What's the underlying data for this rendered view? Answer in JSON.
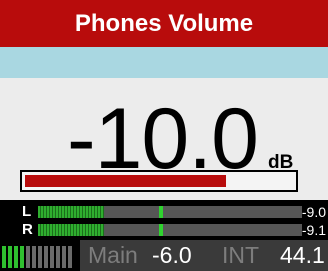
{
  "title": "Phones Volume",
  "volume": {
    "value": "-10.0",
    "unit": "dB",
    "level_fraction": 0.75
  },
  "meters": {
    "left": {
      "label": "L",
      "readout": "-9.0",
      "level_fraction": 0.25,
      "peak_fraction": 0.46
    },
    "right": {
      "label": "R",
      "readout": "-9.1",
      "level_fraction": 0.25,
      "peak_fraction": 0.46
    }
  },
  "status": {
    "source": "Main",
    "source_level": "-6.0",
    "clock": "INT",
    "rate": "44.1"
  },
  "colors": {
    "title_bg": "#b80c0c",
    "info_bg": "#a9d7e1",
    "panel_bg": "#ececec",
    "meter_green": "#2fae2f"
  }
}
